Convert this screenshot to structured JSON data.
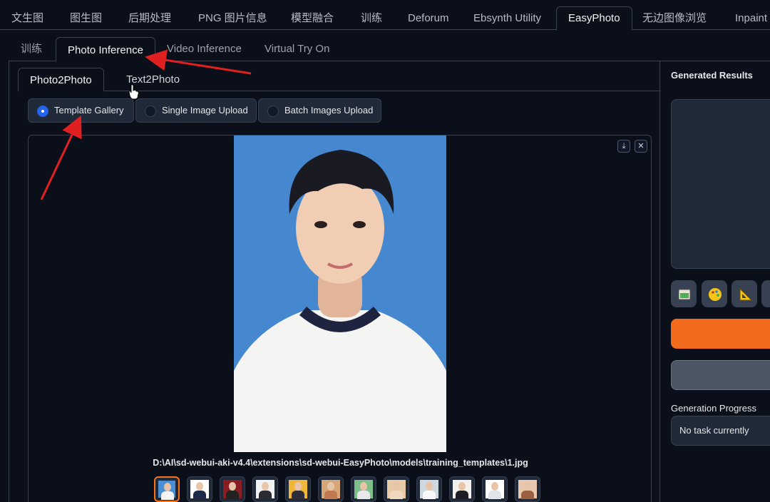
{
  "top_tabs": [
    "文生图",
    "图生图",
    "后期处理",
    "PNG 图片信息",
    "模型融合",
    "训练",
    "Deforum",
    "Ebsynth Utility",
    "EasyPhoto",
    "无边图像浏览",
    "Inpaint"
  ],
  "sub_tabs": [
    "训练",
    "Photo Inference",
    "Video Inference",
    "Virtual Try On"
  ],
  "inner_tabs": [
    "Photo2Photo",
    "Text2Photo"
  ],
  "radio_options": [
    {
      "label": "Template Gallery",
      "checked": true
    },
    {
      "label": "Single Image Upload",
      "checked": false
    },
    {
      "label": "Batch Images Upload",
      "checked": false
    }
  ],
  "gallery": {
    "download_icon": "⤓",
    "close_icon": "✕",
    "caption": "D:\\AI\\sd-webui-aki-v4.4\\extensions\\sd-webui-EasyPhoto\\models\\training_templates\\1.jpg"
  },
  "right_panel": {
    "generated_results": "Generated Results",
    "generation_progress": "Generation Progress",
    "progress_status": "No task currently"
  },
  "colors": {
    "accent_orange": "#f26b1d",
    "radio_blue": "#2563eb",
    "annotation_red": "#e02020"
  }
}
